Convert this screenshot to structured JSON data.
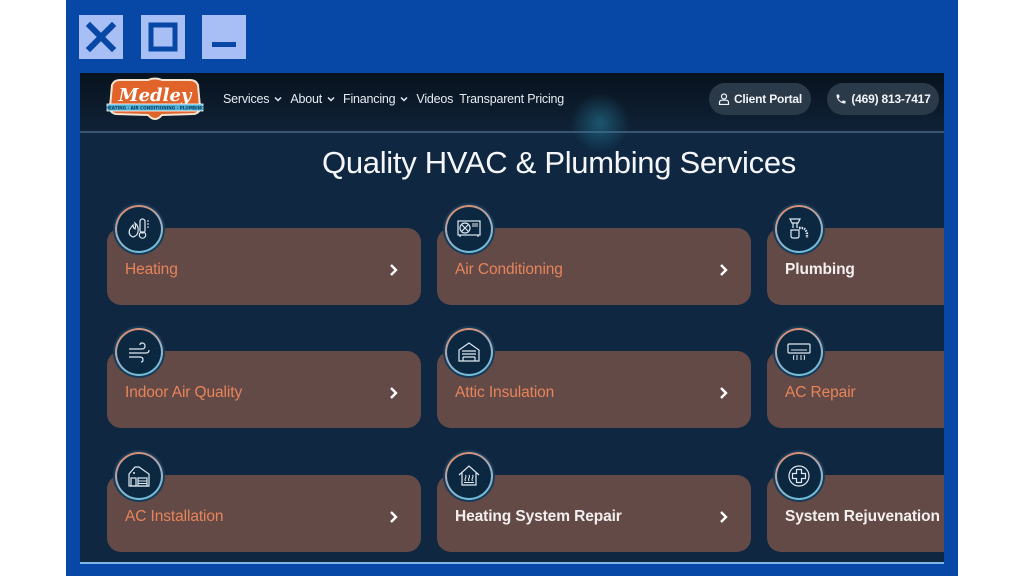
{
  "window_controls": {
    "close": "close-icon",
    "maximize": "maximize-icon",
    "minimize": "minimize-icon",
    "color": "#a8bff5",
    "frame_color": "#0747a6"
  },
  "header": {
    "logo": {
      "name": "Medley",
      "tagline": "HEATING · AIR CONDITIONING · PLUMBING"
    },
    "nav": [
      {
        "label": "Services",
        "has_dropdown": true
      },
      {
        "label": "About",
        "has_dropdown": true
      },
      {
        "label": "Financing",
        "has_dropdown": true
      },
      {
        "label": "Videos",
        "has_dropdown": false
      },
      {
        "label": "Transparent Pricing",
        "has_dropdown": false
      }
    ],
    "client_portal": {
      "label": "Client Portal",
      "icon": "user-icon"
    },
    "phone": {
      "label": "(469) 813-7417",
      "icon": "phone-icon"
    }
  },
  "main": {
    "title": "Quality HVAC & Plumbing Services",
    "services": [
      {
        "label": "Heating",
        "icon": "flame-thermometer-icon",
        "highlight": "orange"
      },
      {
        "label": "Air Conditioning",
        "icon": "ac-unit-icon",
        "highlight": "orange"
      },
      {
        "label": "Plumbing",
        "icon": "pipe-icon",
        "highlight": "white"
      },
      {
        "label": "Indoor Air Quality",
        "icon": "wind-icon",
        "highlight": "orange"
      },
      {
        "label": "Attic Insulation",
        "icon": "attic-icon",
        "highlight": "orange"
      },
      {
        "label": "AC Repair",
        "icon": "wall-ac-icon",
        "highlight": "orange"
      },
      {
        "label": "AC Installation",
        "icon": "house-icon",
        "highlight": "orange"
      },
      {
        "label": "Heating System Repair",
        "icon": "house-heat-icon",
        "highlight": "white"
      },
      {
        "label": "System Rejuvenation",
        "icon": "plus-circle-icon",
        "highlight": "white"
      }
    ]
  },
  "colors": {
    "page_bg": "#0f2740",
    "card_bg": "#634a47",
    "accent_orange": "#e8845a",
    "pill_bg": "#2b3a49"
  }
}
